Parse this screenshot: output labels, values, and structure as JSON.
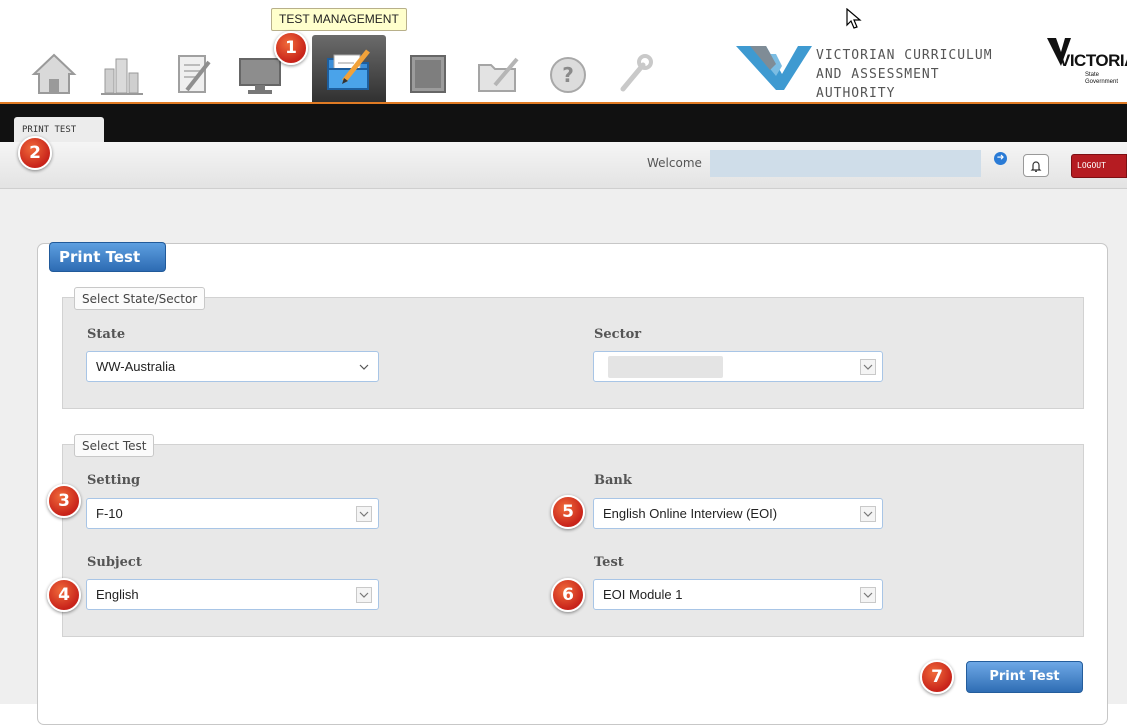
{
  "toolbar": {
    "tooltip": "TEST MANAGEMENT",
    "icons": [
      "home-icon",
      "reports-icon",
      "document-icon",
      "monitor-icon",
      "test-management-icon",
      "binder-icon",
      "folder-edit-icon",
      "help-icon",
      "wrench-icon"
    ],
    "active_icon": "test-management-icon"
  },
  "logos": {
    "vcaa_line1": "VICTORIAN CURRICULUM",
    "vcaa_line2": "AND ASSESSMENT AUTHORITY",
    "vic_title": "VICTORIA",
    "vic_sub_line1": "State",
    "vic_sub_line2": "Government"
  },
  "tabbar": {
    "tab_label": "PRINT TEST"
  },
  "header": {
    "welcome_label": "Welcome",
    "logout_label": "LOGOUT"
  },
  "panel": {
    "title": "Print Test",
    "state_group": {
      "legend": "Select State/Sector",
      "state_label": "State",
      "state_value": "WW-Australia",
      "sector_label": "Sector",
      "sector_value": ""
    },
    "test_group": {
      "legend": "Select Test",
      "setting_label": "Setting",
      "setting_value": "F-10",
      "subject_label": "Subject",
      "subject_value": "English",
      "bank_label": "Bank",
      "bank_value": "English Online Interview (EOI)",
      "test_label": "Test",
      "test_value": "EOI Module 1"
    },
    "print_button": "Print Test"
  },
  "badges": [
    "1",
    "2",
    "3",
    "4",
    "5",
    "6",
    "7"
  ],
  "colors": {
    "accent_orange": "#e07b24",
    "logout_red": "#b51c22",
    "button_blue": "#2f6db4",
    "badge_red": "#d9341f"
  }
}
